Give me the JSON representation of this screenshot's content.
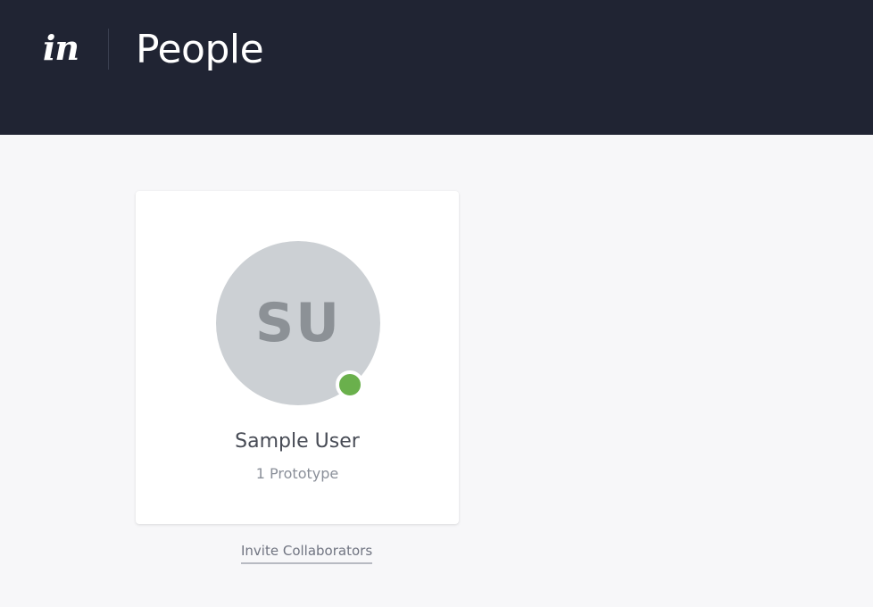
{
  "header": {
    "logo_text": "in",
    "title": "People"
  },
  "colors": {
    "topbar": "#202433",
    "avatar_bg": "#ccd0d4",
    "status_online": "#6ab04c",
    "page_bg": "#f7f7f9"
  },
  "card": {
    "avatar_initials": "SU",
    "name": "Sample User",
    "subtitle": "1 Prototype",
    "status": "online"
  },
  "actions": {
    "invite_label": "Invite Collaborators"
  }
}
